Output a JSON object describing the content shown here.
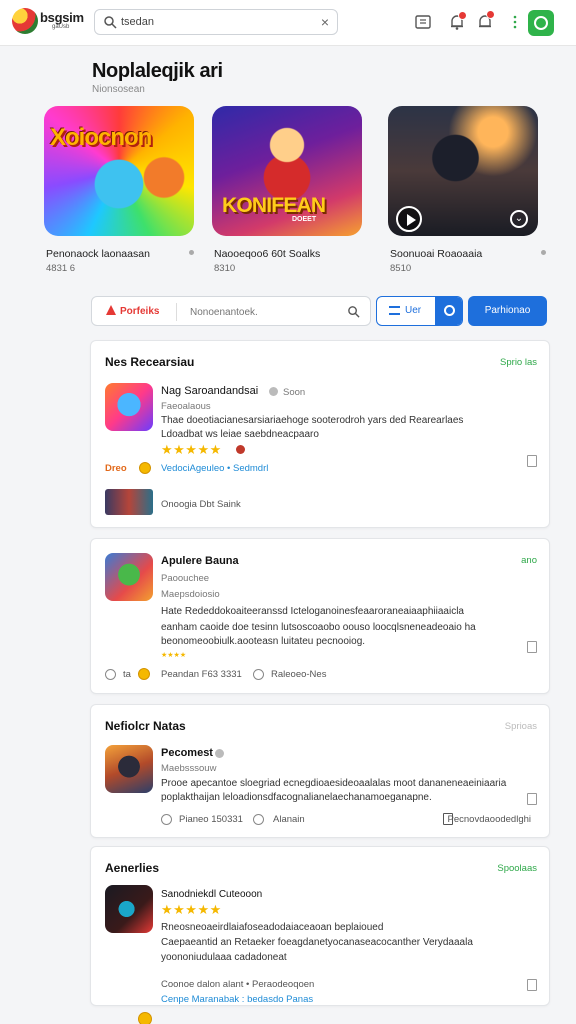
{
  "topbar": {
    "logo_text": "bsgsim",
    "logo_sub": "gaUsb",
    "search_value": "tsedan",
    "search_clear": "×"
  },
  "page": {
    "title": "Noplaleqjik  ari",
    "subtitle": "Nionsosean"
  },
  "featured": [
    {
      "art_title": "Xoiocnon",
      "caption": "Penonaock laonaasan",
      "meta": "4831 6"
    },
    {
      "art_title": "KONIFEAN",
      "art_sub": "DOEET",
      "caption": "Naooeqoo6 60t Soalks",
      "meta": "8310"
    },
    {
      "art_title": "",
      "caption": "Soonuoai Roaoaaia",
      "meta": "8510"
    }
  ],
  "filter": {
    "label": "Porfeiks",
    "placeholder": "Nonoenantoek.",
    "seg_label": "Uer",
    "primary_button": "Parhionao"
  },
  "cards": [
    {
      "header": "Nes Recearsiau",
      "link": "Sprio las",
      "name": "Nag Saroandandsai",
      "name_tag": "Soon",
      "sub": "Faeoalaous",
      "desc": [
        "Thae doeotiacianesarsiariaehoge sooterodroh  yars ded Rearearlaes",
        "Ldoadbat ws leiae saebdneacpaaro"
      ],
      "rating_stars": "★★★★★",
      "promo_prefix": "Dreo",
      "promo_link": "VedociAgeuleo  •  Sedmdrl",
      "related": "Onoogia  Dbt   Saink"
    },
    {
      "header": "Apulere Bauna",
      "link": "ano",
      "name": "Apulere Bauna",
      "sub": "Paoouchee",
      "sub2": "Maepsdoiosio",
      "desc": [
        "Hate Rededdokoaiteeranssd Icteloganoinesfeaaroraneaiaaphiiaaicla",
        "eanham caoide doe tesinn lutsoscoaobo oouso loocqlsneneadeoaio ha",
        "beonomeoobiulk.aooteasn luitateu pecnooiog."
      ],
      "rating_stars": "★★★★",
      "foot_a": "ta",
      "foot_b": "Peandan  F63 3331",
      "foot_c": "Raleoeo-Nes"
    },
    {
      "header": "Nefiolcr Natas",
      "link": "Sprioas",
      "name": "Pecomest",
      "sub": "Maebsssouw",
      "desc": [
        "Prooe apecantoe sloegriad ecnegdioaesideoaalalas  moot dananeneaeiniaaria",
        "poplakthaijan leloadionsdfacognalianelaechanamoeganapne."
      ],
      "foot_a": "Pianeo  150331",
      "foot_b": "Alanain",
      "foot_c": "Pecnovdaoodedlghi"
    },
    {
      "header": "Aenerlies",
      "link": "Spoolaas",
      "name": "Sanodniekdl Cuteooon",
      "rating_stars": "★★★★★",
      "desc": [
        "Rneosneoaeirdlaiafoseadodaiaceaoan beplaioued",
        "Caepaeantid an Retaeker foeagdanetyocanaseacocanther Verydaaala",
        "yoononiudulaaa cadadoneat"
      ],
      "foot_a": "Coonoe dalon alant  •  Peraodeoqoen",
      "foot_b": "Cenpe Maranabak :  bedasdo Panas"
    }
  ],
  "colors": {
    "accent_blue": "#1e6fdc",
    "accent_green": "#2fa84a",
    "alert_red": "#e53935",
    "star_yellow": "#f5b800"
  }
}
